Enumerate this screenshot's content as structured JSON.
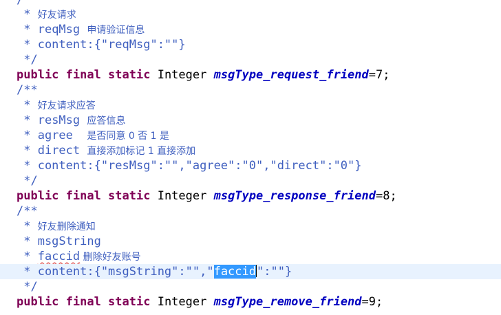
{
  "colors": {
    "comment": "#3f5fbf",
    "keyword": "#7f0055",
    "field": "#0000c0",
    "current_line": "#e8f2fe",
    "selection": "#3399ff"
  },
  "code": {
    "l0": "/",
    "l1_star": " * ",
    "l1_text": "好友请求",
    "l2_star": " * ",
    "l2_tag": "reqMsg ",
    "l2_text": "申请验证信息",
    "l3": " * content:{\"reqMsg\":\"\"}",
    "l4": " */",
    "l5_mod": "public final static",
    "l5_type": " Integer ",
    "l5_field": "msgType_request_friend",
    "l5_rest": "=7;",
    "l6": "/**",
    "l7_star": " * ",
    "l7_text": "好友请求应答",
    "l8_star": " * ",
    "l8_tag": "resMsg ",
    "l8_text": "应答信息",
    "l9_star": " * ",
    "l9_tag": "agree  ",
    "l9_text": "是否同意 0 否 1 是",
    "l10_star": " * ",
    "l10_tag": "direct ",
    "l10_text": "直接添加标记 1 直接添加",
    "l11": " * content:{\"resMsg\":\"\",\"agree\":\"0\",\"direct\":\"0\"}",
    "l12": " */",
    "l13_mod": "public final static",
    "l13_type": " Integer ",
    "l13_field": "msgType_response_friend",
    "l13_rest": "=8;",
    "l14": "/**",
    "l15_star": " * ",
    "l15_text": "好友删除通知",
    "l16": " * msgString",
    "l17_star": " * ",
    "l17_tag": "faccid",
    "l17_text": " 删除好友账号",
    "l18_pre": " * content:{\"msgString\":\"\",\"",
    "l18_sel": "faccid",
    "l18_post": "\":\"\"}",
    "l19": " */",
    "l20_mod": "public final static",
    "l20_type": " Integer ",
    "l20_field": "msgType_remove_friend",
    "l20_rest": "=9;"
  }
}
